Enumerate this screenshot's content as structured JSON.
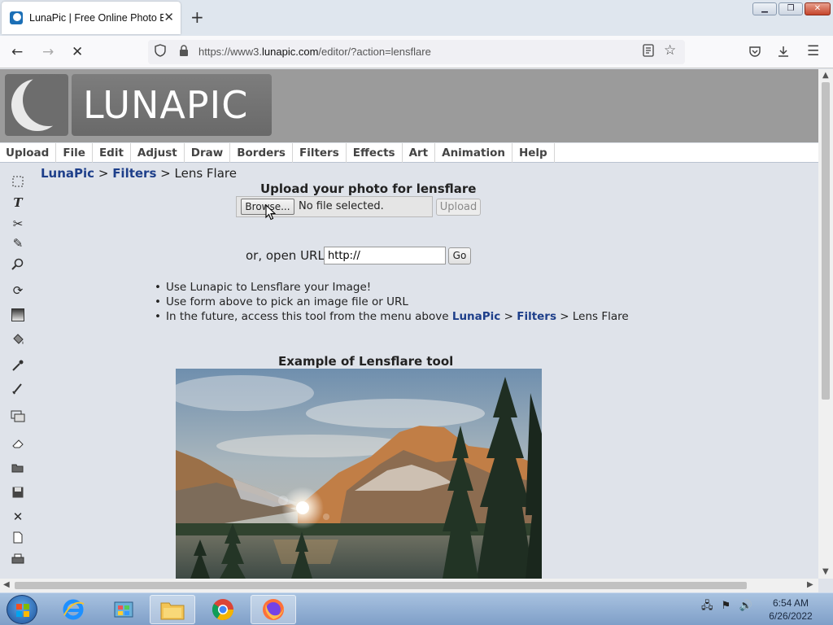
{
  "browser": {
    "tab_title": "LunaPic | Free Online Photo Edi",
    "tab_close": "✕",
    "new_tab": "+",
    "url_host_prefix": "https://www3.",
    "url_host": "lunapic.com",
    "url_path": "/editor/?action=lensflare",
    "window_controls": {
      "minimize": "▁",
      "maximize": "❐",
      "close": "✕"
    }
  },
  "site": {
    "logo_text": "LUNAPIC",
    "menu": [
      "Upload",
      "File",
      "Edit",
      "Adjust",
      "Draw",
      "Borders",
      "Filters",
      "Effects",
      "Art",
      "Animation",
      "Help"
    ],
    "tools": [
      "select-icon",
      "text-icon",
      "scissors-icon",
      "pencil-icon",
      "zoom-icon",
      "rotate-icon",
      "gradient-icon",
      "paint-bucket-icon",
      "eyedropper-icon",
      "brush-icon",
      "layers-icon",
      "eraser-icon",
      "open-folder-icon",
      "save-icon",
      "close-icon",
      "new-file-icon",
      "print-icon"
    ]
  },
  "breadcrumb": {
    "root": "LunaPic",
    "sep1": " > ",
    "section": "Filters",
    "sep2": " > ",
    "current": "Lens Flare"
  },
  "upload": {
    "title": "Upload your photo for lensflare",
    "browse_label": "Browse...",
    "file_status": "No file selected.",
    "upload_label": "Upload"
  },
  "url_form": {
    "label": "or, open URL",
    "value": "http://",
    "go_label": "Go"
  },
  "bullets": {
    "item1": "Use Lunapic to Lensflare your Image!",
    "item2": "Use form above to pick an image file or URL",
    "item3_prefix": "In the future, access this tool from the menu above ",
    "item3_link1": "LunaPic",
    "item3_sep1": " > ",
    "item3_link2": "Filters",
    "item3_suffix": " > Lens Flare"
  },
  "example": {
    "title": "Example of Lensflare tool"
  },
  "taskbar": {
    "time": "6:54 AM",
    "date": "6/26/2022"
  }
}
